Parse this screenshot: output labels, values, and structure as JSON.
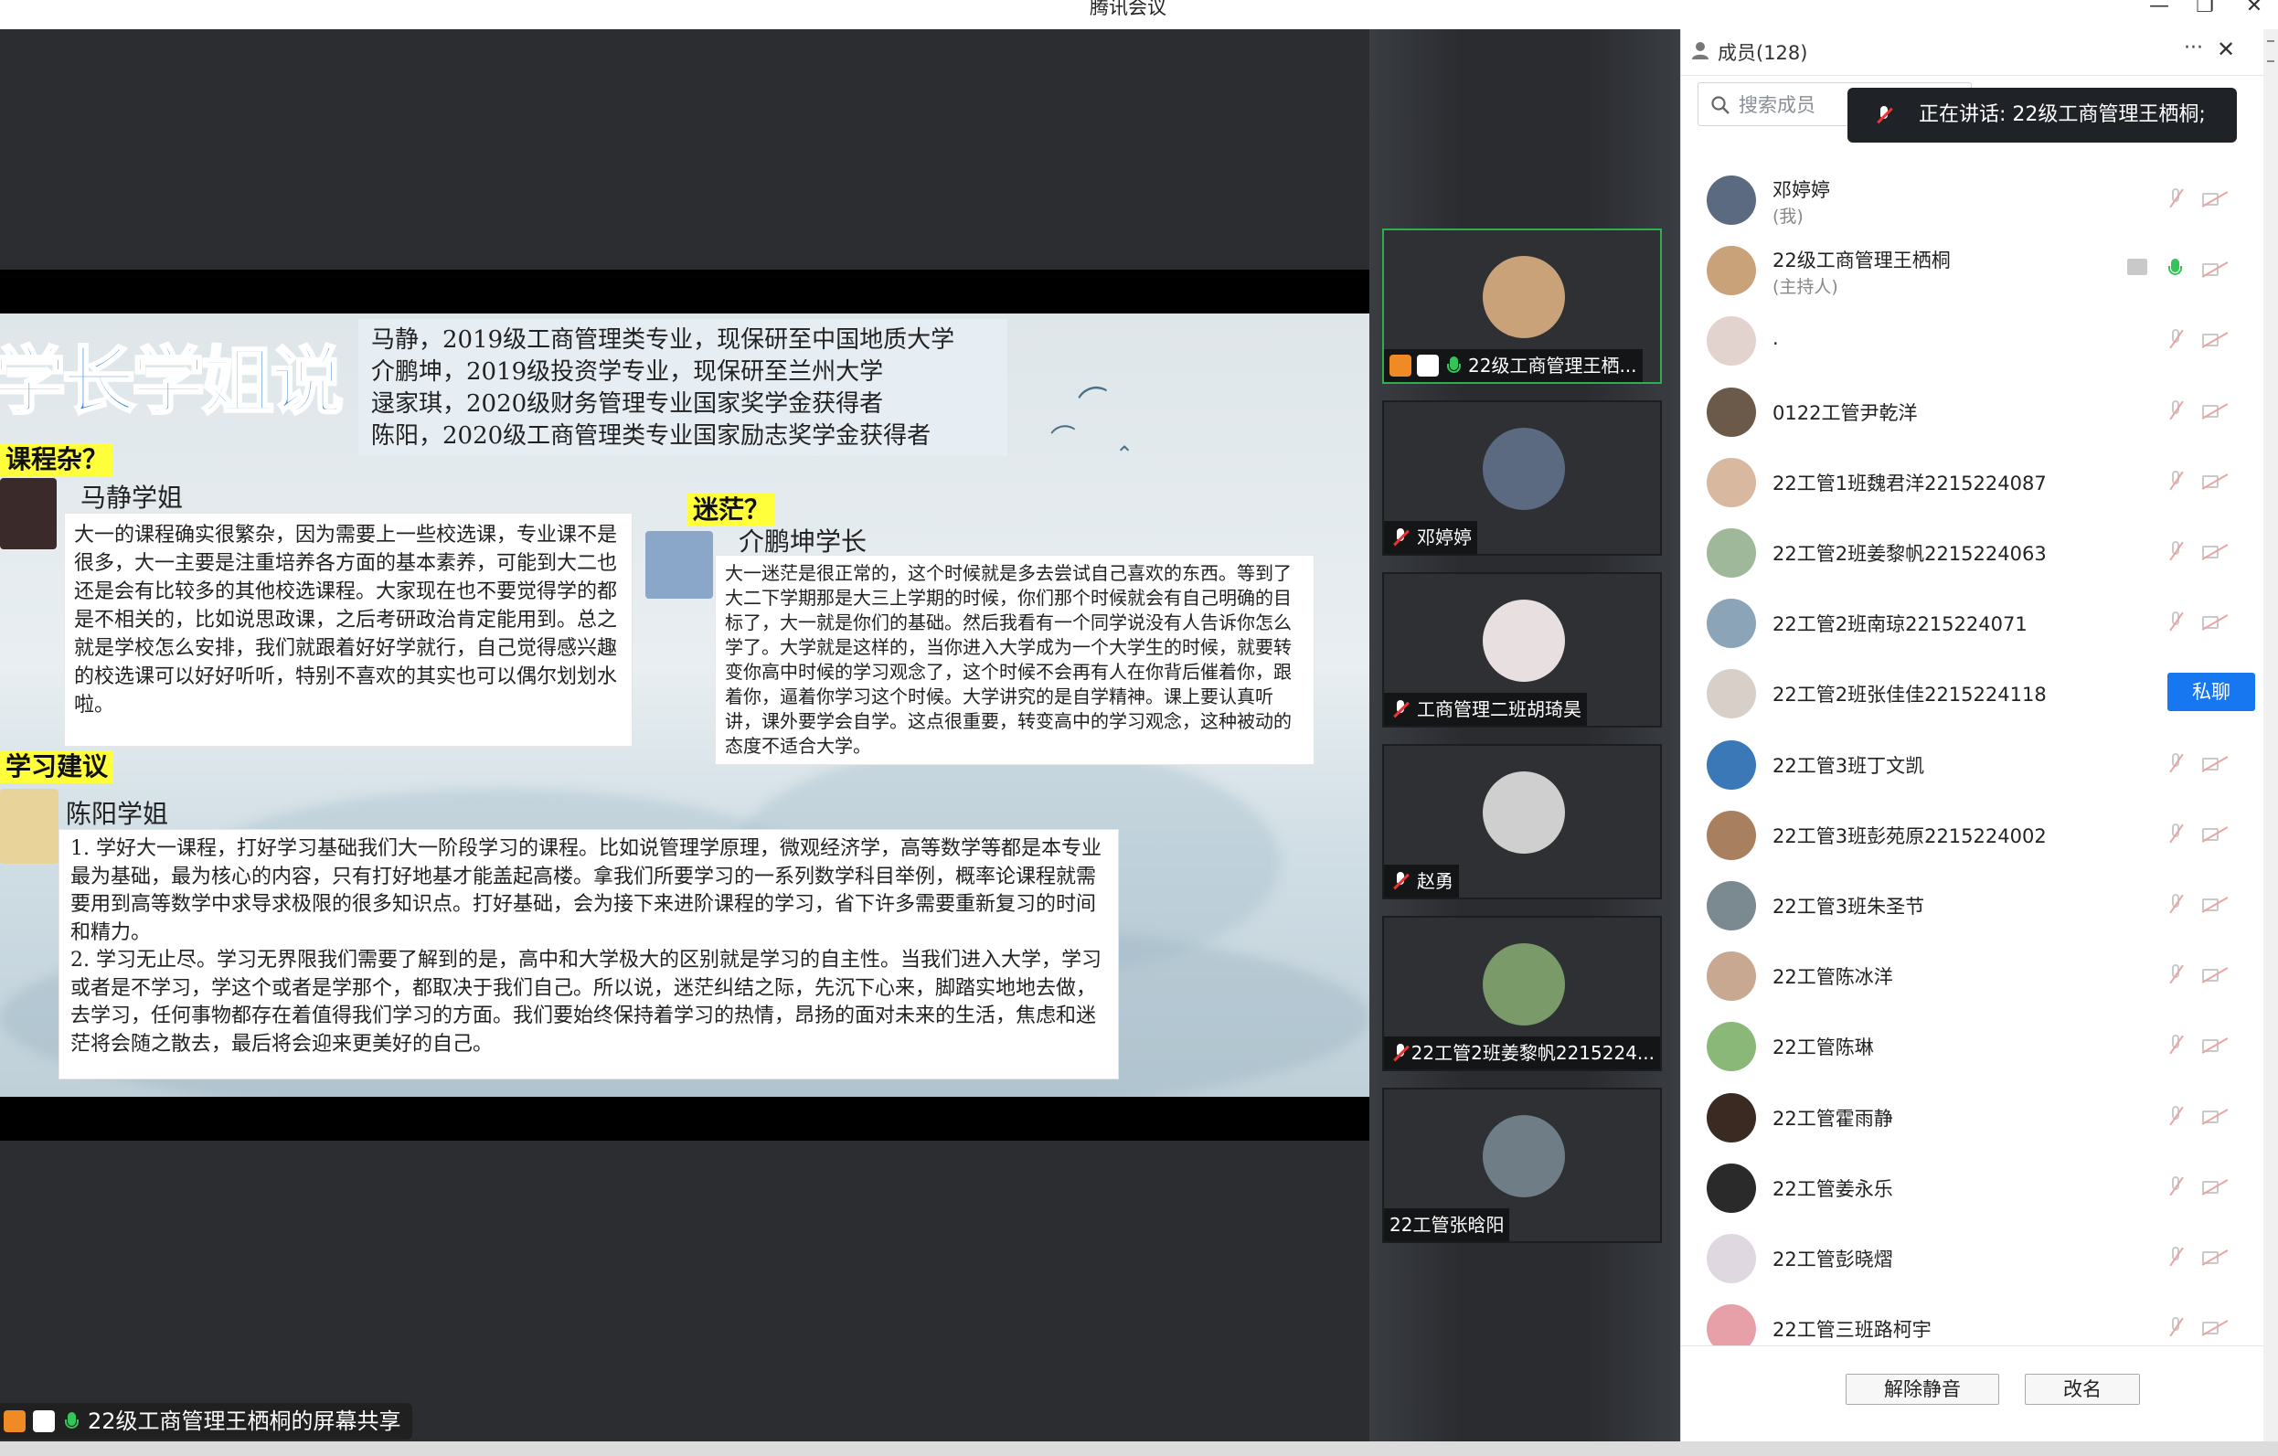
{
  "window": {
    "title": "腾讯会议",
    "minimize": "—",
    "maximize": "❐",
    "close": "✕"
  },
  "slide": {
    "title": "学长学姐说",
    "intro_lines": [
      "马静，2019级工商管理类专业，现保研至中国地质大学",
      "介鹏坤，2019级投资学专业，现保研至兰州大学",
      "逯家琪，2020级财务管理专业国家奖学金获得者",
      "陈阳，2020级工商管理类专业国家励志奖学金获得者"
    ],
    "tag1": "课程杂？",
    "name1": "马静学姐",
    "text1": "大一的课程确实很繁杂，因为需要上一些校选课，专业课不是很多，大一主要是注重培养各方面的基本素养，可能到大二也还是会有比较多的其他校选课程。大家现在也不要觉得学的都是不相关的，比如说思政课，之后考研政治肯定能用到。总之就是学校怎么安排，我们就跟着好好学就行，自己觉得感兴趣的校选课可以好好听听，特别不喜欢的其实也可以偶尔划划水啦。",
    "tag2": "迷茫？",
    "name2": "介鹏坤学长",
    "text2": "大一迷茫是很正常的，这个时候就是多去尝试自己喜欢的东西。等到了大二下学期那是大三上学期的时候，你们那个时候就会有自己明确的目标了，大一就是你们的基础。然后我看有一个同学说没有人告诉你怎么学了。大学就是这样的，当你进入大学成为一个大学生的时候，就要转变你高中时候的学习观念了，这个时候不会再有人在你背后催着你，跟着你，逼着你学习这个时候。大学讲究的是自学精神。课上要认真听讲，课外要学会自学。这点很重要，转变高中的学习观念，这种被动的态度不适合大学。",
    "tag3": "学习建议",
    "name3": "陈阳学姐",
    "text3a": "1. 学好大一课程，打好学习基础我们大一阶段学习的课程。比如说管理学原理，微观经济学，高等数学等都是本专业最为基础，最为核心的内容，只有打好地基才能盖起高楼。拿我们所要学习的一系列数学科目举例，概率论课程就需要用到高等数学中求导求极限的很多知识点。打好基础，会为接下来进阶课程的学习，省下许多需要重新复习的时间和精力。",
    "text3b": "2. 学习无止尽。学习无界限我们需要了解到的是，高中和大学极大的区别就是学习的自主性。当我们进入大学，学习或者是不学习，学这个或者是学那个，都取决于我们自己。所以说，迷茫纠结之际，先沉下心来，脚踏实地地去做，去学习，任何事物都存在着值得我们学习的方面。我们要始终保持着学习的热情，昂扬的面对未来的生活，焦虑和迷茫将会随之散去，最后将会迎来更美好的自己。"
  },
  "share_caption": "22级工商管理王栖桐的屏幕共享",
  "video_tiles": [
    {
      "name": "22级工商管理王栖...",
      "color": "#c9a27a"
    },
    {
      "name": "邓婷婷",
      "color": "#5b6a80"
    },
    {
      "name": "工商管理二班胡琦昊",
      "color": "#e8e0e0"
    },
    {
      "name": "赵勇",
      "color": "#cfcfcf"
    },
    {
      "name": "22工管2班姜黎帆2215224...",
      "color": "#7a9a6a"
    },
    {
      "name": "22工管张晗阳",
      "color": "#6e7d86"
    }
  ],
  "panel": {
    "title": "成员(128)",
    "more": "···",
    "close": "✕",
    "search_placeholder": "搜索成员",
    "speaking": "正在讲话: 22级工商管理王栖桐;",
    "dm_button": "私聊",
    "unmute_button": "解除静音",
    "rename_button": "改名"
  },
  "members": [
    {
      "name": "邓婷婷",
      "sub": "(我)",
      "color": "#5b6a80"
    },
    {
      "name": "22级工商管理王栖桐",
      "sub": "(主持人)",
      "color": "#c9a27a"
    },
    {
      "name": ".",
      "sub": "",
      "color": "#e3d3cf"
    },
    {
      "name": "0122工管尹乾洋",
      "sub": "",
      "color": "#6b5a4a"
    },
    {
      "name": "22工管1班魏君洋2215224087",
      "sub": "",
      "color": "#d9b8a0"
    },
    {
      "name": "22工管2班姜黎帆2215224063",
      "sub": "",
      "color": "#a0b89a"
    },
    {
      "name": "22工管2班南琼2215224071",
      "sub": "",
      "color": "#8ca4b8"
    },
    {
      "name": "22工管2班张佳佳2215224118",
      "sub": "",
      "color": "#d8d0c8"
    },
    {
      "name": "22工管3班丁文凯",
      "sub": "",
      "color": "#3a78b8"
    },
    {
      "name": "22工管3班彭苑原2215224002",
      "sub": "",
      "color": "#a88060"
    },
    {
      "name": "22工管3班朱圣节",
      "sub": "",
      "color": "#7a8a90"
    },
    {
      "name": "22工管陈冰洋",
      "sub": "",
      "color": "#c8a890"
    },
    {
      "name": "22工管陈琳",
      "sub": "",
      "color": "#8ab878"
    },
    {
      "name": "22工管霍雨静",
      "sub": "",
      "color": "#3a2a22"
    },
    {
      "name": "22工管姜永乐",
      "sub": "",
      "color": "#2a2a2a"
    },
    {
      "name": "22工管彭晓熠",
      "sub": "",
      "color": "#e0d8e0"
    },
    {
      "name": "22工管三班路柯宇",
      "sub": "",
      "color": "#e8a0a8"
    }
  ]
}
